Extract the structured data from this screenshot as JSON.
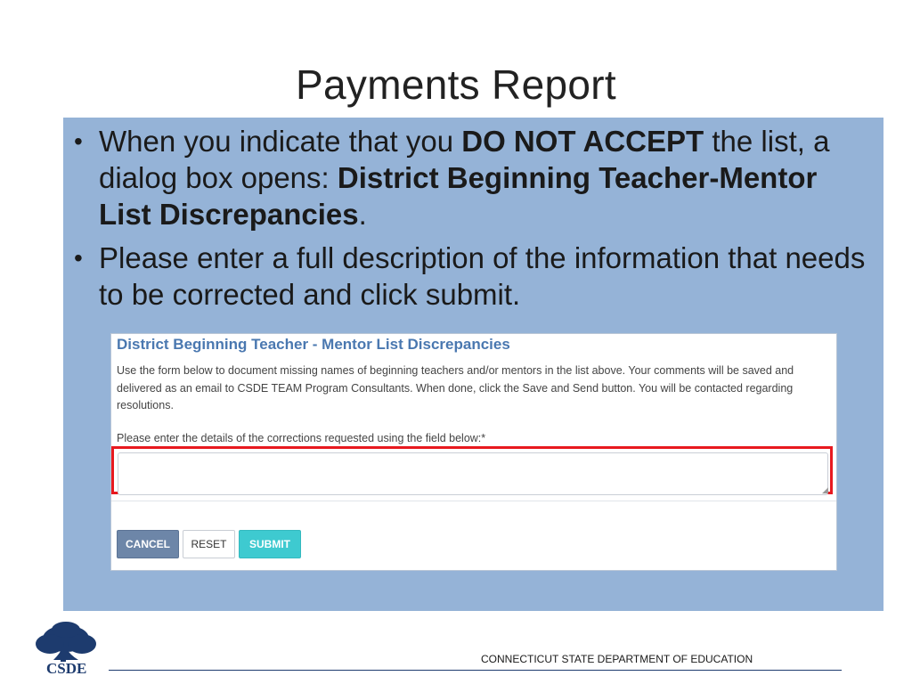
{
  "slide": {
    "title": "Payments Report"
  },
  "bullets": [
    {
      "parts": [
        {
          "text": "When you indicate that you ",
          "bold": false
        },
        {
          "text": "DO NOT ACCEPT",
          "bold": true
        },
        {
          "text": " the list, a dialog box opens: ",
          "bold": false
        },
        {
          "text": "District Beginning Teacher-Mentor List Discrepancies",
          "bold": true
        },
        {
          "text": ".",
          "bold": false
        }
      ]
    },
    {
      "parts": [
        {
          "text": "Please enter a full description of the information that needs to be corrected and click submit.",
          "bold": false
        }
      ]
    }
  ],
  "dialog": {
    "title": "District Beginning Teacher - Mentor List Discrepancies",
    "description": "Use the form below to document missing names of beginning teachers and/or mentors in the list above. Your comments will be saved and delivered as an email to CSDE TEAM Program Consultants. When done, click the Save and Send button. You will be contacted regarding resolutions.",
    "field_label": "Please enter the details of the corrections requested using the field below:*",
    "field_value": "",
    "buttons": {
      "cancel": "CANCEL",
      "reset": "RESET",
      "submit": "SUBMIT"
    }
  },
  "footer": {
    "logo_text": "CSDE",
    "department": "CONNECTICUT STATE DEPARTMENT OF EDUCATION"
  },
  "colors": {
    "panel": "#95b3d7",
    "highlight": "#e8191f",
    "dialog_title": "#4a78b0",
    "cancel": "#6d86a8",
    "submit": "#3ecad0",
    "brand": "#1d3b6e"
  },
  "icons": {
    "logo": "oak-tree-icon",
    "resize": "resize-grip-icon"
  }
}
